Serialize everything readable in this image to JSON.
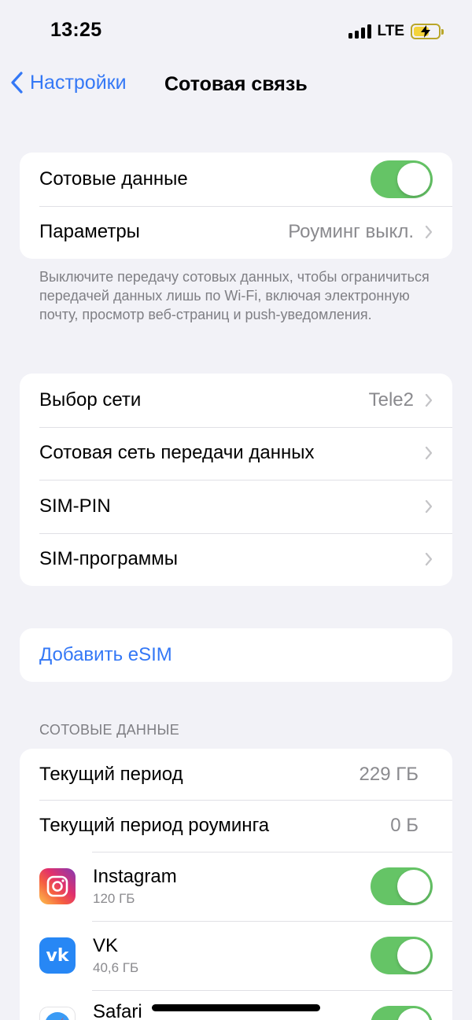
{
  "status_bar": {
    "time": "13:25",
    "network": "LTE",
    "battery_state": "charging",
    "battery_color": "#f4d33b"
  },
  "nav": {
    "back_label": "Настройки",
    "title": "Сотовая связь",
    "back_icon": "chevron-left-icon"
  },
  "group1": {
    "cellular_data_label": "Сотовые данные",
    "cellular_data_on": true,
    "params_label": "Параметры",
    "params_value": "Роуминг выкл."
  },
  "note": "Выключите передачу сотовых данных, чтобы ограничиться передачей данных лишь по Wi-Fi, включая электронную почту, просмотр веб-страниц и push-уведомления.",
  "group2": {
    "items": [
      {
        "label": "Выбор сети",
        "value": "Tele2"
      },
      {
        "label": "Сотовая сеть передачи данных",
        "value": ""
      },
      {
        "label": "SIM-PIN",
        "value": ""
      },
      {
        "label": "SIM-программы",
        "value": ""
      }
    ]
  },
  "add_esim": {
    "label": "Добавить eSIM"
  },
  "usage": {
    "header": "СОТОВЫЕ ДАННЫЕ",
    "current_period_label": "Текущий период",
    "current_period_value": "229 ГБ",
    "roaming_period_label": "Текущий период роуминга",
    "roaming_period_value": "0 Б",
    "apps": [
      {
        "name": "Instagram",
        "size": "120 ГБ",
        "icon": "instagram-icon",
        "enabled": true
      },
      {
        "name": "VK",
        "size": "40,6 ГБ",
        "icon": "vk-icon",
        "enabled": true
      },
      {
        "name": "Safari",
        "size": "",
        "icon": "safari-icon",
        "enabled": true
      }
    ]
  },
  "colors": {
    "accent": "#3478f6",
    "toggle_on": "#65c466",
    "background": "#f2f2f7"
  }
}
